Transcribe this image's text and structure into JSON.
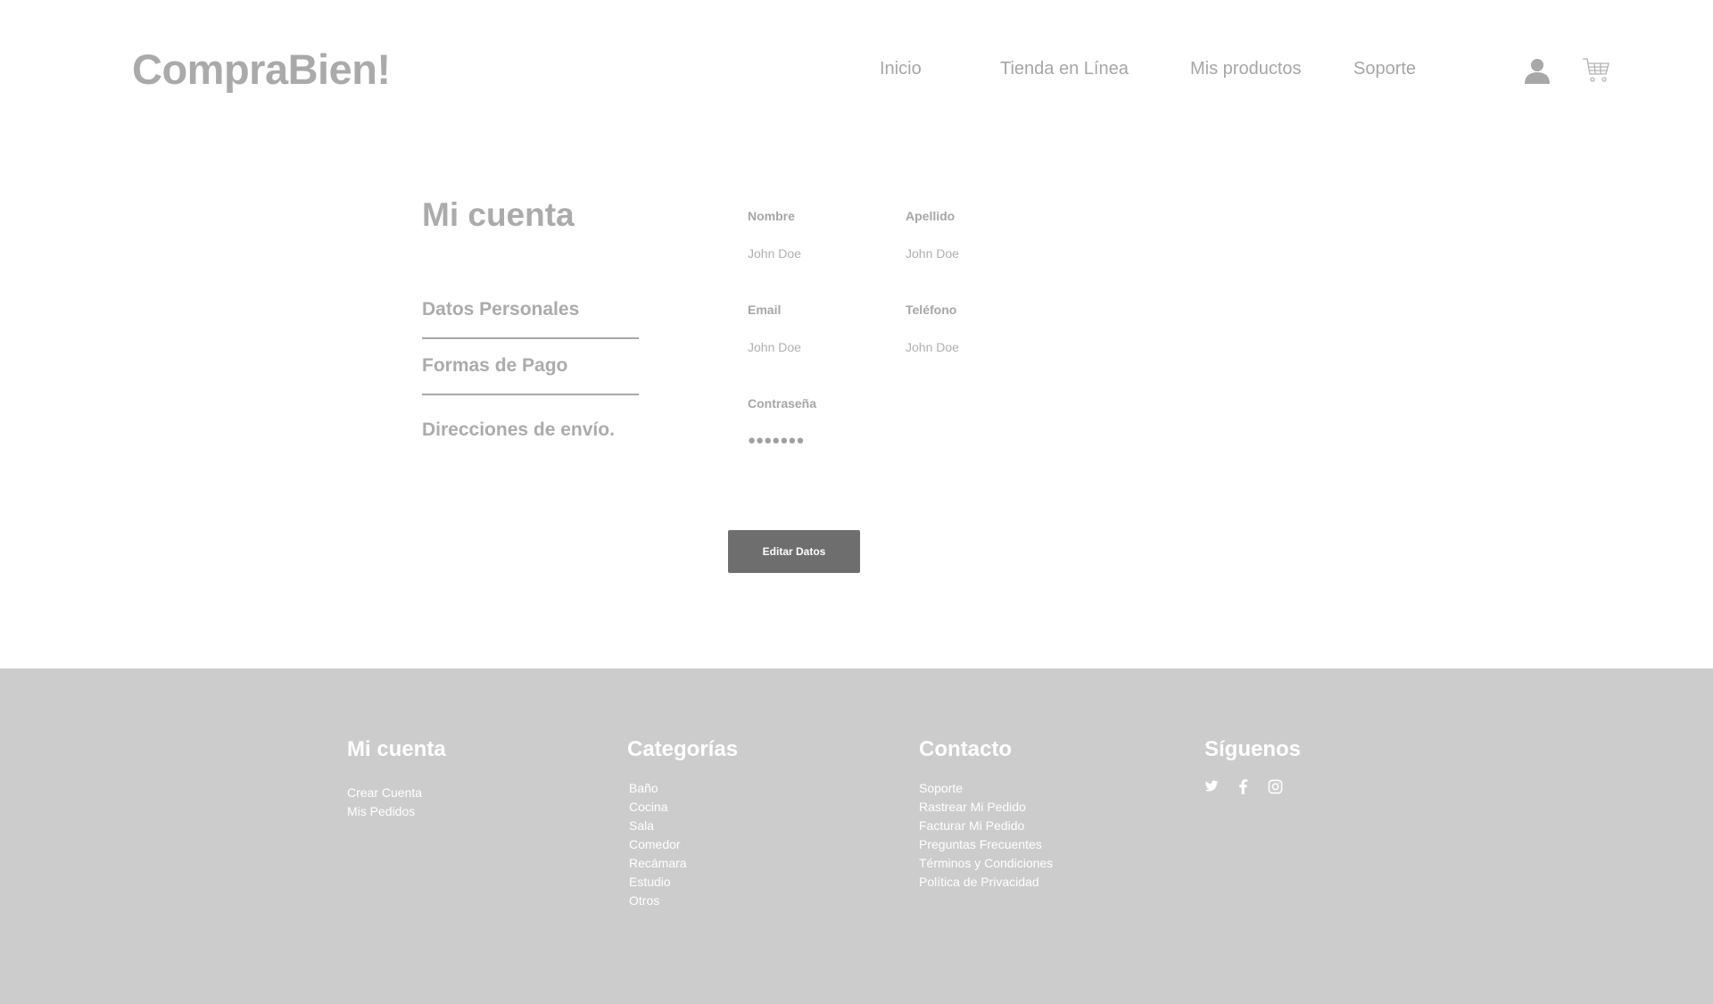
{
  "header": {
    "logo": "CompraBien!",
    "nav": [
      "Inicio",
      "Tienda en Línea",
      "Mis productos",
      "Soporte"
    ],
    "icons": [
      "user-icon",
      "cart-icon"
    ]
  },
  "account": {
    "title": "Mi cuenta",
    "sidebar": [
      "Datos Personales",
      "Formas de Pago",
      "Direcciones de envío."
    ],
    "fields": {
      "nombre": {
        "label": "Nombre",
        "value": "John Doe"
      },
      "apellido": {
        "label": "Apellido",
        "value": "John Doe"
      },
      "email": {
        "label": "Email",
        "value": "John Doe"
      },
      "telefono": {
        "label": "Teléfono",
        "value": "John Doe"
      },
      "contrasena": {
        "label": "Contraseña",
        "value": "●●●●●●●"
      }
    },
    "edit_button": "Editar Datos"
  },
  "footer": {
    "mi_cuenta": {
      "heading": "Mi cuenta",
      "links": [
        "Crear Cuenta",
        "Mis Pedidos"
      ]
    },
    "categorias": {
      "heading": "Categorías",
      "links": [
        "Baño",
        "Cocina",
        "Sala",
        "Comedor",
        "Recámara",
        "Estudio",
        "Otros"
      ]
    },
    "contacto": {
      "heading": "Contacto",
      "links": [
        "Soporte",
        "Rastrear Mi Pedido",
        "Facturar Mi Pedido",
        "Preguntas Frecuentes",
        "Términos y Condiciones",
        "Política de Privacidad"
      ]
    },
    "siguenos": {
      "heading": "Síguenos",
      "icons": [
        "twitter-icon",
        "facebook-icon",
        "instagram-icon"
      ]
    }
  },
  "colors": {
    "footer_bg": "#cccccc",
    "button_bg": "#6e6e6e",
    "text_gray": "#a8a8a8"
  }
}
